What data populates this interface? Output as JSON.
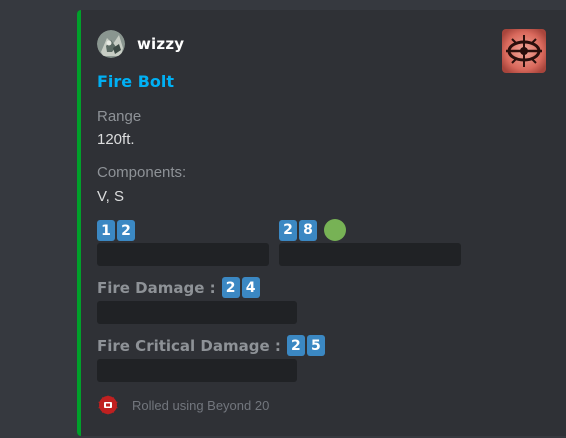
{
  "colors": {
    "accent_bar": "#00a02a",
    "title": "#00b0f4",
    "dice_digit_bg": "#3b88c3",
    "green_indicator": "#77b255",
    "spoiler_bg": "#202225",
    "beyond20_red": "#c02020"
  },
  "author": {
    "name": "wizzy",
    "avatar_icon": "wizard-avatar"
  },
  "thumbnail_icon": "fire-bolt-spell-icon",
  "title": "Fire Bolt",
  "fields": {
    "range_label": "Range",
    "range_value": "120ft.",
    "components_label": "Components:",
    "components_value": "V, S"
  },
  "rolls": {
    "attack_1_digits": [
      "1",
      "2"
    ],
    "attack_2_digits": [
      "2",
      "8"
    ],
    "fire_damage_label": "Fire Damage :",
    "fire_damage_digits": [
      "2",
      "4"
    ],
    "fire_crit_label": "Fire Critical Damage :",
    "fire_crit_digits": [
      "2",
      "5"
    ]
  },
  "footer": {
    "icon": "beyond20-logo-icon",
    "text": "Rolled using Beyond 20"
  }
}
